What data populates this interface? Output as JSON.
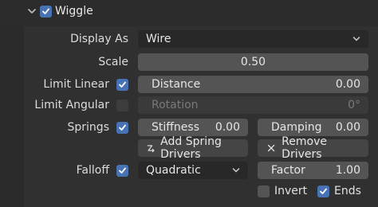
{
  "header": {
    "title": "Wiggle",
    "enabled": true
  },
  "display_as": {
    "label": "Display As",
    "value": "Wire"
  },
  "scale": {
    "label": "Scale",
    "value": "0.50"
  },
  "limit_linear": {
    "label": "Limit Linear",
    "checked": true,
    "field_label": "Distance",
    "field_value": "0.00"
  },
  "limit_angular": {
    "label": "Limit Angular",
    "checked": false,
    "field_label": "Rotation",
    "field_value": "0°"
  },
  "springs": {
    "label": "Springs",
    "checked": true,
    "stiffness_label": "Stiffness",
    "stiffness_value": "0.00",
    "damping_label": "Damping",
    "damping_value": "0.00",
    "add_drivers_label": "Add Spring Drivers",
    "remove_drivers_label": "Remove Drivers"
  },
  "falloff": {
    "label": "Falloff",
    "checked": true,
    "type_value": "Quadratic",
    "factor_label": "Factor",
    "factor_value": "1.00",
    "invert_label": "Invert",
    "invert_checked": false,
    "ends_label": "Ends",
    "ends_checked": true
  },
  "colors": {
    "accent": "#4772b3",
    "field": "#545454",
    "background": "#303030"
  }
}
